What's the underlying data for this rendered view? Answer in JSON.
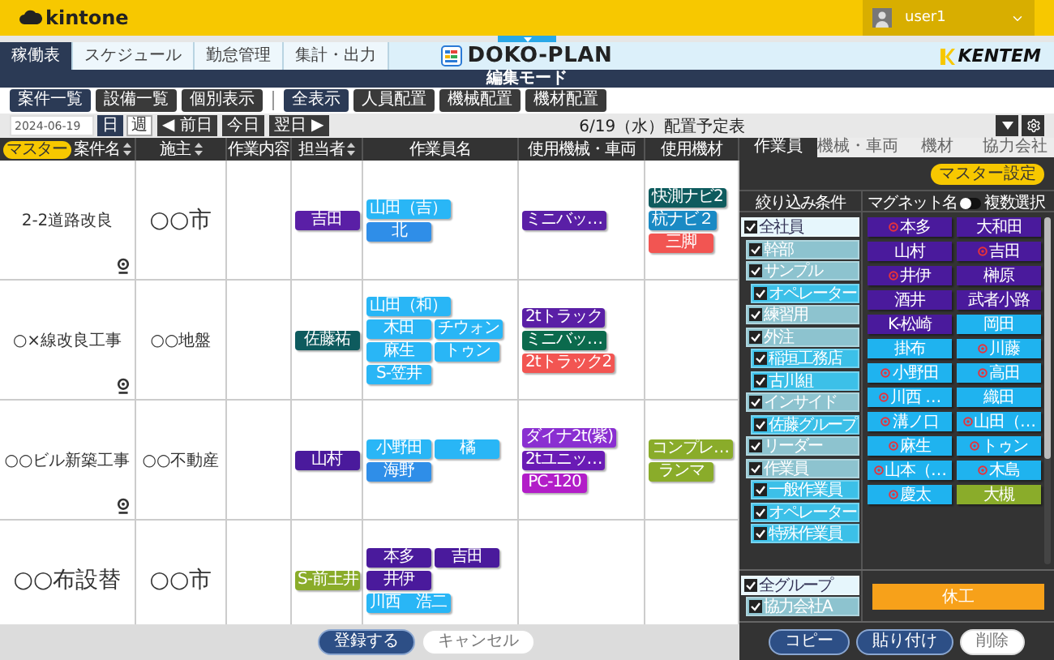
{
  "app_bar": {
    "brand": "kintone",
    "user": "user1"
  },
  "nav_tabs": [
    {
      "label": "稼働表",
      "selected": true
    },
    {
      "label": "スケジュール",
      "selected": false
    },
    {
      "label": "勤怠管理",
      "selected": false
    },
    {
      "label": "集計・出力",
      "selected": false
    }
  ],
  "logo": "DOKO-PLAN",
  "maker": "KENTEM",
  "mode_label": "編集モード",
  "view_groups": [
    [
      {
        "label": "案件一覧",
        "selected": true
      },
      {
        "label": "設備一覧",
        "selected": false
      },
      {
        "label": "個別表示",
        "selected": false
      }
    ],
    [
      {
        "label": "全表示",
        "selected": true
      },
      {
        "label": "人員配置",
        "selected": false
      },
      {
        "label": "機械配置",
        "selected": false
      },
      {
        "label": "機材配置",
        "selected": false
      }
    ]
  ],
  "date_bar": {
    "date": "2024-06-19",
    "periods": [
      {
        "label": "日",
        "selected": true
      },
      {
        "label": "週",
        "selected": false
      }
    ],
    "steps": [
      "◀ 前日",
      "今日",
      "翌日 ▶"
    ],
    "title": "6/19（水）配置予定表"
  },
  "table": {
    "master_badge": "マスター",
    "columns": [
      {
        "label": "案件名",
        "sortable": true
      },
      {
        "label": "施主",
        "sortable": true
      },
      {
        "label": "作業内容",
        "sortable": false
      },
      {
        "label": "担当者",
        "sortable": true
      },
      {
        "label": "作業員名",
        "sortable": false
      },
      {
        "label": "使用機械・車両",
        "sortable": false
      },
      {
        "label": "使用機材",
        "sortable": false
      }
    ],
    "rows": [
      {
        "project": "2-2道路改良",
        "owner": "○○市",
        "pin": true,
        "manager": {
          "name": "吉田",
          "color": "#5a1fa6"
        },
        "workers": [
          {
            "name": "山田（吉）",
            "color": "#29b6f6"
          },
          {
            "name": "北",
            "color": "#2f8ee8"
          }
        ],
        "machines": [
          {
            "name": "ミニバッ…",
            "color": "#5a1fa6"
          }
        ],
        "materials": [
          {
            "name": "快測ナビ2",
            "color": "#0e5b5e"
          },
          {
            "name": "杭ナビ２",
            "color": "#1a8ac4"
          },
          {
            "name": "三脚",
            "color": "#f25552"
          }
        ]
      },
      {
        "project": "○×線改良工事",
        "owner": "○○地盤",
        "pin": true,
        "manager": {
          "name": "佐藤祐",
          "color": "#0e5b5e"
        },
        "workers": [
          {
            "name": "山田（和）",
            "color": "#29b6f6"
          },
          {
            "name": "木田",
            "color": "#29b6f6"
          },
          {
            "name": "チウォン",
            "color": "#29b6f6"
          },
          {
            "name": "麻生",
            "color": "#29b6f6"
          },
          {
            "name": "トゥン",
            "color": "#29b6f6"
          },
          {
            "name": "S-笠井",
            "color": "#29b6f6"
          }
        ],
        "machines": [
          {
            "name": "2tトラック",
            "color": "#5a1fa6"
          },
          {
            "name": "ミニバッ…",
            "color": "#0b6a4d"
          },
          {
            "name": "2tトラック2",
            "color": "#f25552"
          }
        ]
      },
      {
        "project": "○○ビル新築工事",
        "owner": "○○不動産",
        "pin": true,
        "manager": {
          "name": "山村",
          "color": "#4a1a9c"
        },
        "workers": [
          {
            "name": "小野田",
            "color": "#29b6f6"
          },
          {
            "name": "橘",
            "color": "#29b6f6"
          },
          {
            "name": "海野",
            "color": "#2f8ee8"
          }
        ],
        "machines": [
          {
            "name": "ダイナ2t(紫)",
            "color": "#8a2fd1"
          },
          {
            "name": "2tユニッ…",
            "color": "#6a1bb5"
          },
          {
            "name": "PC-120",
            "color": "#b21dc8"
          }
        ],
        "materials": [
          {
            "name": "コンプレ…",
            "color": "#8aac2a"
          },
          {
            "name": "ランマ",
            "color": "#8aac2a"
          }
        ]
      },
      {
        "project": "○○布設替",
        "owner": "○○市",
        "pin": false,
        "manager": {
          "name": "S-前土井",
          "color": "#8aac2a"
        },
        "workers": [
          {
            "name": "本多",
            "color": "#4a1a9c"
          },
          {
            "name": "吉田",
            "color": "#4a1a9c"
          },
          {
            "name": "井伊",
            "color": "#4a1a9c"
          },
          {
            "name": "川西　浩二",
            "color": "#29b6f6"
          }
        ]
      }
    ]
  },
  "footer": {
    "buttons": [
      {
        "label": "登録する",
        "kind": "primary"
      },
      {
        "label": "キャンセル",
        "kind": "plain"
      }
    ]
  },
  "panel": {
    "tabs": [
      {
        "label": "作業員",
        "selected": true
      },
      {
        "label": "機械・車両",
        "selected": false
      },
      {
        "label": "機材",
        "selected": false
      },
      {
        "label": "協力会社",
        "selected": false
      }
    ],
    "master_button": "マスター設定",
    "filter_heading": "絞り込み条件",
    "magnet_heading": "マグネット名",
    "multi_select": {
      "label": "複数選択",
      "on": false
    },
    "filters": [
      {
        "label": "全社員",
        "checked": true,
        "children": [
          {
            "label": "幹部",
            "checked": true
          },
          {
            "label": "サンプル",
            "checked": true,
            "children": [
              {
                "label": "オペレーター",
                "checked": true
              }
            ]
          },
          {
            "label": "練習用",
            "checked": true
          },
          {
            "label": "外注",
            "checked": true,
            "children": [
              {
                "label": "稲垣工務店",
                "checked": true
              },
              {
                "label": "古川組",
                "checked": true
              }
            ]
          },
          {
            "label": "インサイド",
            "checked": true,
            "children": [
              {
                "label": "佐藤グループ",
                "checked": true
              }
            ]
          },
          {
            "label": "リーダー",
            "checked": true
          },
          {
            "label": "作業員",
            "checked": true,
            "children": [
              {
                "label": "一般作業員",
                "checked": true
              },
              {
                "label": "オペレーター",
                "checked": true
              },
              {
                "label": "特殊作業員",
                "checked": true
              }
            ]
          }
        ]
      }
    ],
    "groups": [
      {
        "label": "全グループ",
        "checked": true,
        "children": [
          {
            "label": "協力会社A",
            "checked": true
          }
        ]
      }
    ],
    "magnets": [
      {
        "name": "本多",
        "color": "#4a1a9c",
        "marked": true
      },
      {
        "name": "大和田",
        "color": "#4a1a9c",
        "marked": false
      },
      {
        "name": "山村",
        "color": "#4a1a9c",
        "marked": false
      },
      {
        "name": "吉田",
        "color": "#4a1a9c",
        "marked": true
      },
      {
        "name": "井伊",
        "color": "#4a1a9c",
        "marked": true
      },
      {
        "name": "榊原",
        "color": "#4a1a9c",
        "marked": false
      },
      {
        "name": "酒井",
        "color": "#4a1a9c",
        "marked": false
      },
      {
        "name": "武者小路",
        "color": "#4a1a9c",
        "marked": false
      },
      {
        "name": "K-松崎",
        "color": "#4a1a9c",
        "marked": false
      },
      {
        "name": "岡田",
        "color": "#1fb3ef",
        "marked": false
      },
      {
        "name": "掛布",
        "color": "#1fb3ef",
        "marked": false
      },
      {
        "name": "川藤",
        "color": "#1fb3ef",
        "marked": true
      },
      {
        "name": "小野田",
        "color": "#1fb3ef",
        "marked": true
      },
      {
        "name": "高田",
        "color": "#1fb3ef",
        "marked": true
      },
      {
        "name": "川西 …",
        "color": "#1fb3ef",
        "marked": true
      },
      {
        "name": "織田",
        "color": "#1fb3ef",
        "marked": false
      },
      {
        "name": "溝ノ口",
        "color": "#1fb3ef",
        "marked": true
      },
      {
        "name": "山田（…",
        "color": "#1fb3ef",
        "marked": true
      },
      {
        "name": "麻生",
        "color": "#1fb3ef",
        "marked": true
      },
      {
        "name": "トゥン",
        "color": "#1fb3ef",
        "marked": true
      },
      {
        "name": "山本（…",
        "color": "#1fb3ef",
        "marked": true
      },
      {
        "name": "木島",
        "color": "#1fb3ef",
        "marked": true
      },
      {
        "name": "慶太",
        "color": "#1fb3ef",
        "marked": true
      },
      {
        "name": "大槻",
        "color": "#8aac2a",
        "marked": false
      }
    ],
    "holiday_button": "休工",
    "actions": [
      {
        "label": "コピー",
        "kind": "primary"
      },
      {
        "label": "貼り付け",
        "kind": "primary"
      },
      {
        "label": "削除",
        "kind": "plain"
      }
    ]
  }
}
